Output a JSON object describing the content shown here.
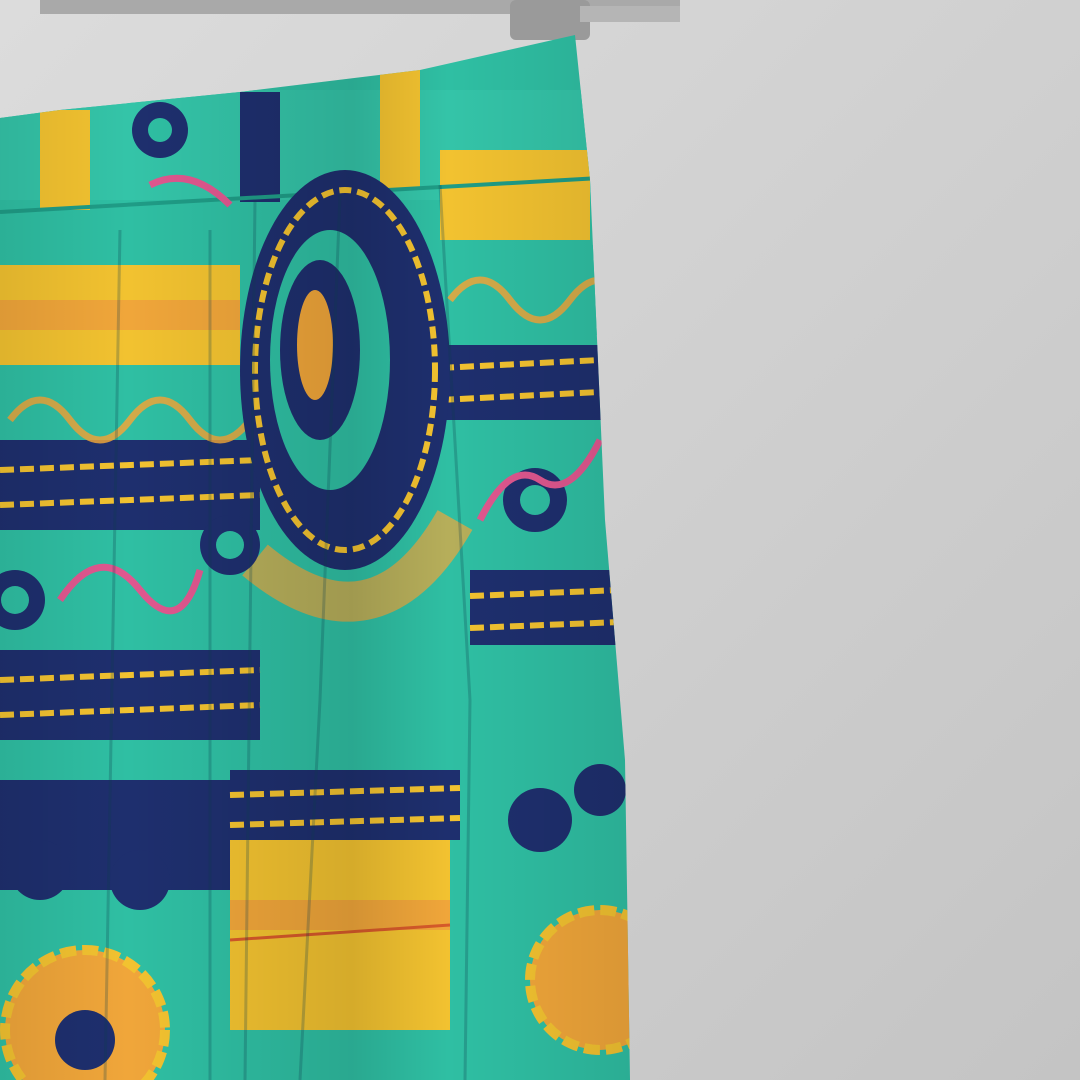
{
  "photo": {
    "subject": "patterned-garment-on-hanger",
    "colors": {
      "backdrop": "#c9c9c9",
      "backdrop_light": "#d8d8d8",
      "turquoise": "#2fbfa3",
      "turquoise_dark": "#1f9c86",
      "navy": "#1e2f6e",
      "yellow": "#f2c230",
      "orange": "#f0a63a",
      "pink": "#e0578f",
      "hanger": "#b8b8b8"
    }
  }
}
